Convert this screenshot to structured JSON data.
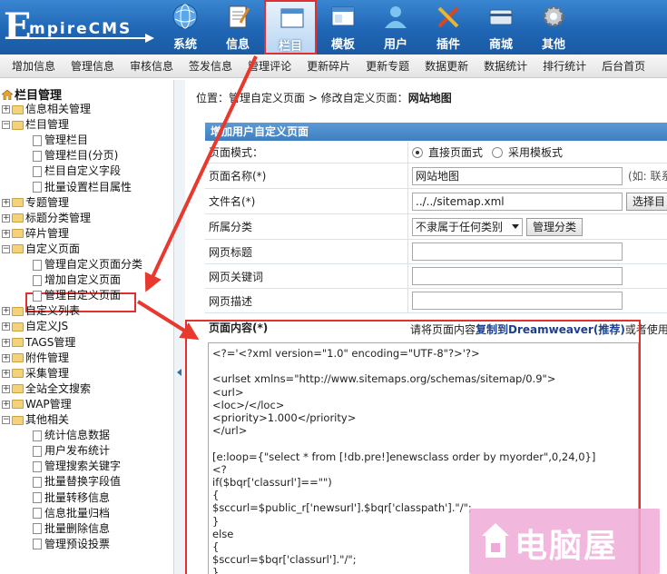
{
  "logo": {
    "letter": "E",
    "rest": "mpireCMS"
  },
  "nav": [
    {
      "label": "系统",
      "icon": "globe-icon"
    },
    {
      "label": "信息",
      "icon": "notepad-icon"
    },
    {
      "label": "栏目",
      "icon": "window-icon",
      "active": true
    },
    {
      "label": "模板",
      "icon": "template-window-icon"
    },
    {
      "label": "用户",
      "icon": "user-icon"
    },
    {
      "label": "插件",
      "icon": "tools-icon"
    },
    {
      "label": "商城",
      "icon": "card-icon"
    },
    {
      "label": "其他",
      "icon": "gear-icon"
    }
  ],
  "subnav": [
    "增加信息",
    "管理信息",
    "审核信息",
    "签发信息",
    "管理评论",
    "更新碎片",
    "更新专题",
    "数据更新",
    "数据统计",
    "排行统计",
    "后台首页"
  ],
  "sidebar": {
    "title": "栏目管理",
    "items": [
      {
        "label": "信息相关管理",
        "level": 0,
        "type": "folder",
        "open": false
      },
      {
        "label": "栏目管理",
        "level": 0,
        "type": "folder",
        "open": true
      },
      {
        "label": "管理栏目",
        "level": 1,
        "type": "doc"
      },
      {
        "label": "管理栏目(分页)",
        "level": 1,
        "type": "doc"
      },
      {
        "label": "栏目自定义字段",
        "level": 1,
        "type": "doc"
      },
      {
        "label": "批量设置栏目属性",
        "level": 1,
        "type": "doc"
      },
      {
        "label": "专题管理",
        "level": 0,
        "type": "folder",
        "open": false
      },
      {
        "label": "标题分类管理",
        "level": 0,
        "type": "folder",
        "open": false
      },
      {
        "label": "碎片管理",
        "level": 0,
        "type": "folder",
        "open": false
      },
      {
        "label": "自定义页面",
        "level": 0,
        "type": "folder",
        "open": true
      },
      {
        "label": "管理自定义页面分类",
        "level": 1,
        "type": "doc"
      },
      {
        "label": "增加自定义页面",
        "level": 1,
        "type": "doc"
      },
      {
        "label": "管理自定义页面",
        "level": 1,
        "type": "doc",
        "highlight": true
      },
      {
        "label": "自定义列表",
        "level": 0,
        "type": "folder",
        "open": false
      },
      {
        "label": "自定义JS",
        "level": 0,
        "type": "folder",
        "open": false
      },
      {
        "label": "TAGS管理",
        "level": 0,
        "type": "folder",
        "open": false
      },
      {
        "label": "附件管理",
        "level": 0,
        "type": "folder",
        "open": false
      },
      {
        "label": "采集管理",
        "level": 0,
        "type": "folder",
        "open": false
      },
      {
        "label": "全站全文搜索",
        "level": 0,
        "type": "folder",
        "open": false
      },
      {
        "label": "WAP管理",
        "level": 0,
        "type": "folder",
        "open": false
      },
      {
        "label": "其他相关",
        "level": 0,
        "type": "folder",
        "open": true
      },
      {
        "label": "统计信息数据",
        "level": 1,
        "type": "doc"
      },
      {
        "label": "用户发布统计",
        "level": 1,
        "type": "doc"
      },
      {
        "label": "管理搜索关键字",
        "level": 1,
        "type": "doc"
      },
      {
        "label": "批量替换字段值",
        "level": 1,
        "type": "doc"
      },
      {
        "label": "批量转移信息",
        "level": 1,
        "type": "doc"
      },
      {
        "label": "信息批量归档",
        "level": 1,
        "type": "doc"
      },
      {
        "label": "批量删除信息",
        "level": 1,
        "type": "doc"
      },
      {
        "label": "管理预设投票",
        "level": 1,
        "type": "doc"
      }
    ]
  },
  "breadcrumb": {
    "prefix": "位置：管理自定义页面 > 修改自定义页面：",
    "current": "网站地图"
  },
  "form": {
    "title": "增加用户自定义页面",
    "mode_label": "页面模式：",
    "mode_options": [
      "直接页面式",
      "采用模板式"
    ],
    "name_label": "页面名称(*)",
    "name_value": "网站地图",
    "name_hint": "(如: 联系",
    "file_label": "文件名(*)",
    "file_value": "../../sitemap.xml",
    "file_button": "选择目",
    "category_label": "所属分类",
    "category_value": "不隶属于任何类别",
    "category_button": "管理分类",
    "page_title_label": "网页标题",
    "keywords_label": "网页关键词",
    "desc_label": "网页描述",
    "content_label": "页面内容(*)",
    "content_hint_a": "请将页面内容",
    "content_hint_b": "复制到Dreamweaver(推荐)",
    "content_hint_c": "或者使用",
    "content_code": "<?='<?xml version=\"1.0\" encoding=\"UTF-8\"?>'?>\n\n<urlset xmlns=\"http://www.sitemaps.org/schemas/sitemap/0.9\">\n<url>\n<loc>/</loc>\n<priority>1.000</priority>\n</url>\n\n[e:loop={\"select * from [!db.pre!]enewsclass order by myorder\",0,24,0}]\n<?\nif($bqr['classurl']==\"\")\n{\n$sccurl=$public_r['newsurl'].$bqr['classpath'].\"/\";\n}\nelse\n{\n$sccurl=$bqr['classurl'].\"/\";\n}"
  },
  "watermark": {
    "text": "电脑屋"
  },
  "colors": {
    "header": "#1f66b4",
    "highlight": "#e03131",
    "form_head": "#3f7fc0"
  }
}
